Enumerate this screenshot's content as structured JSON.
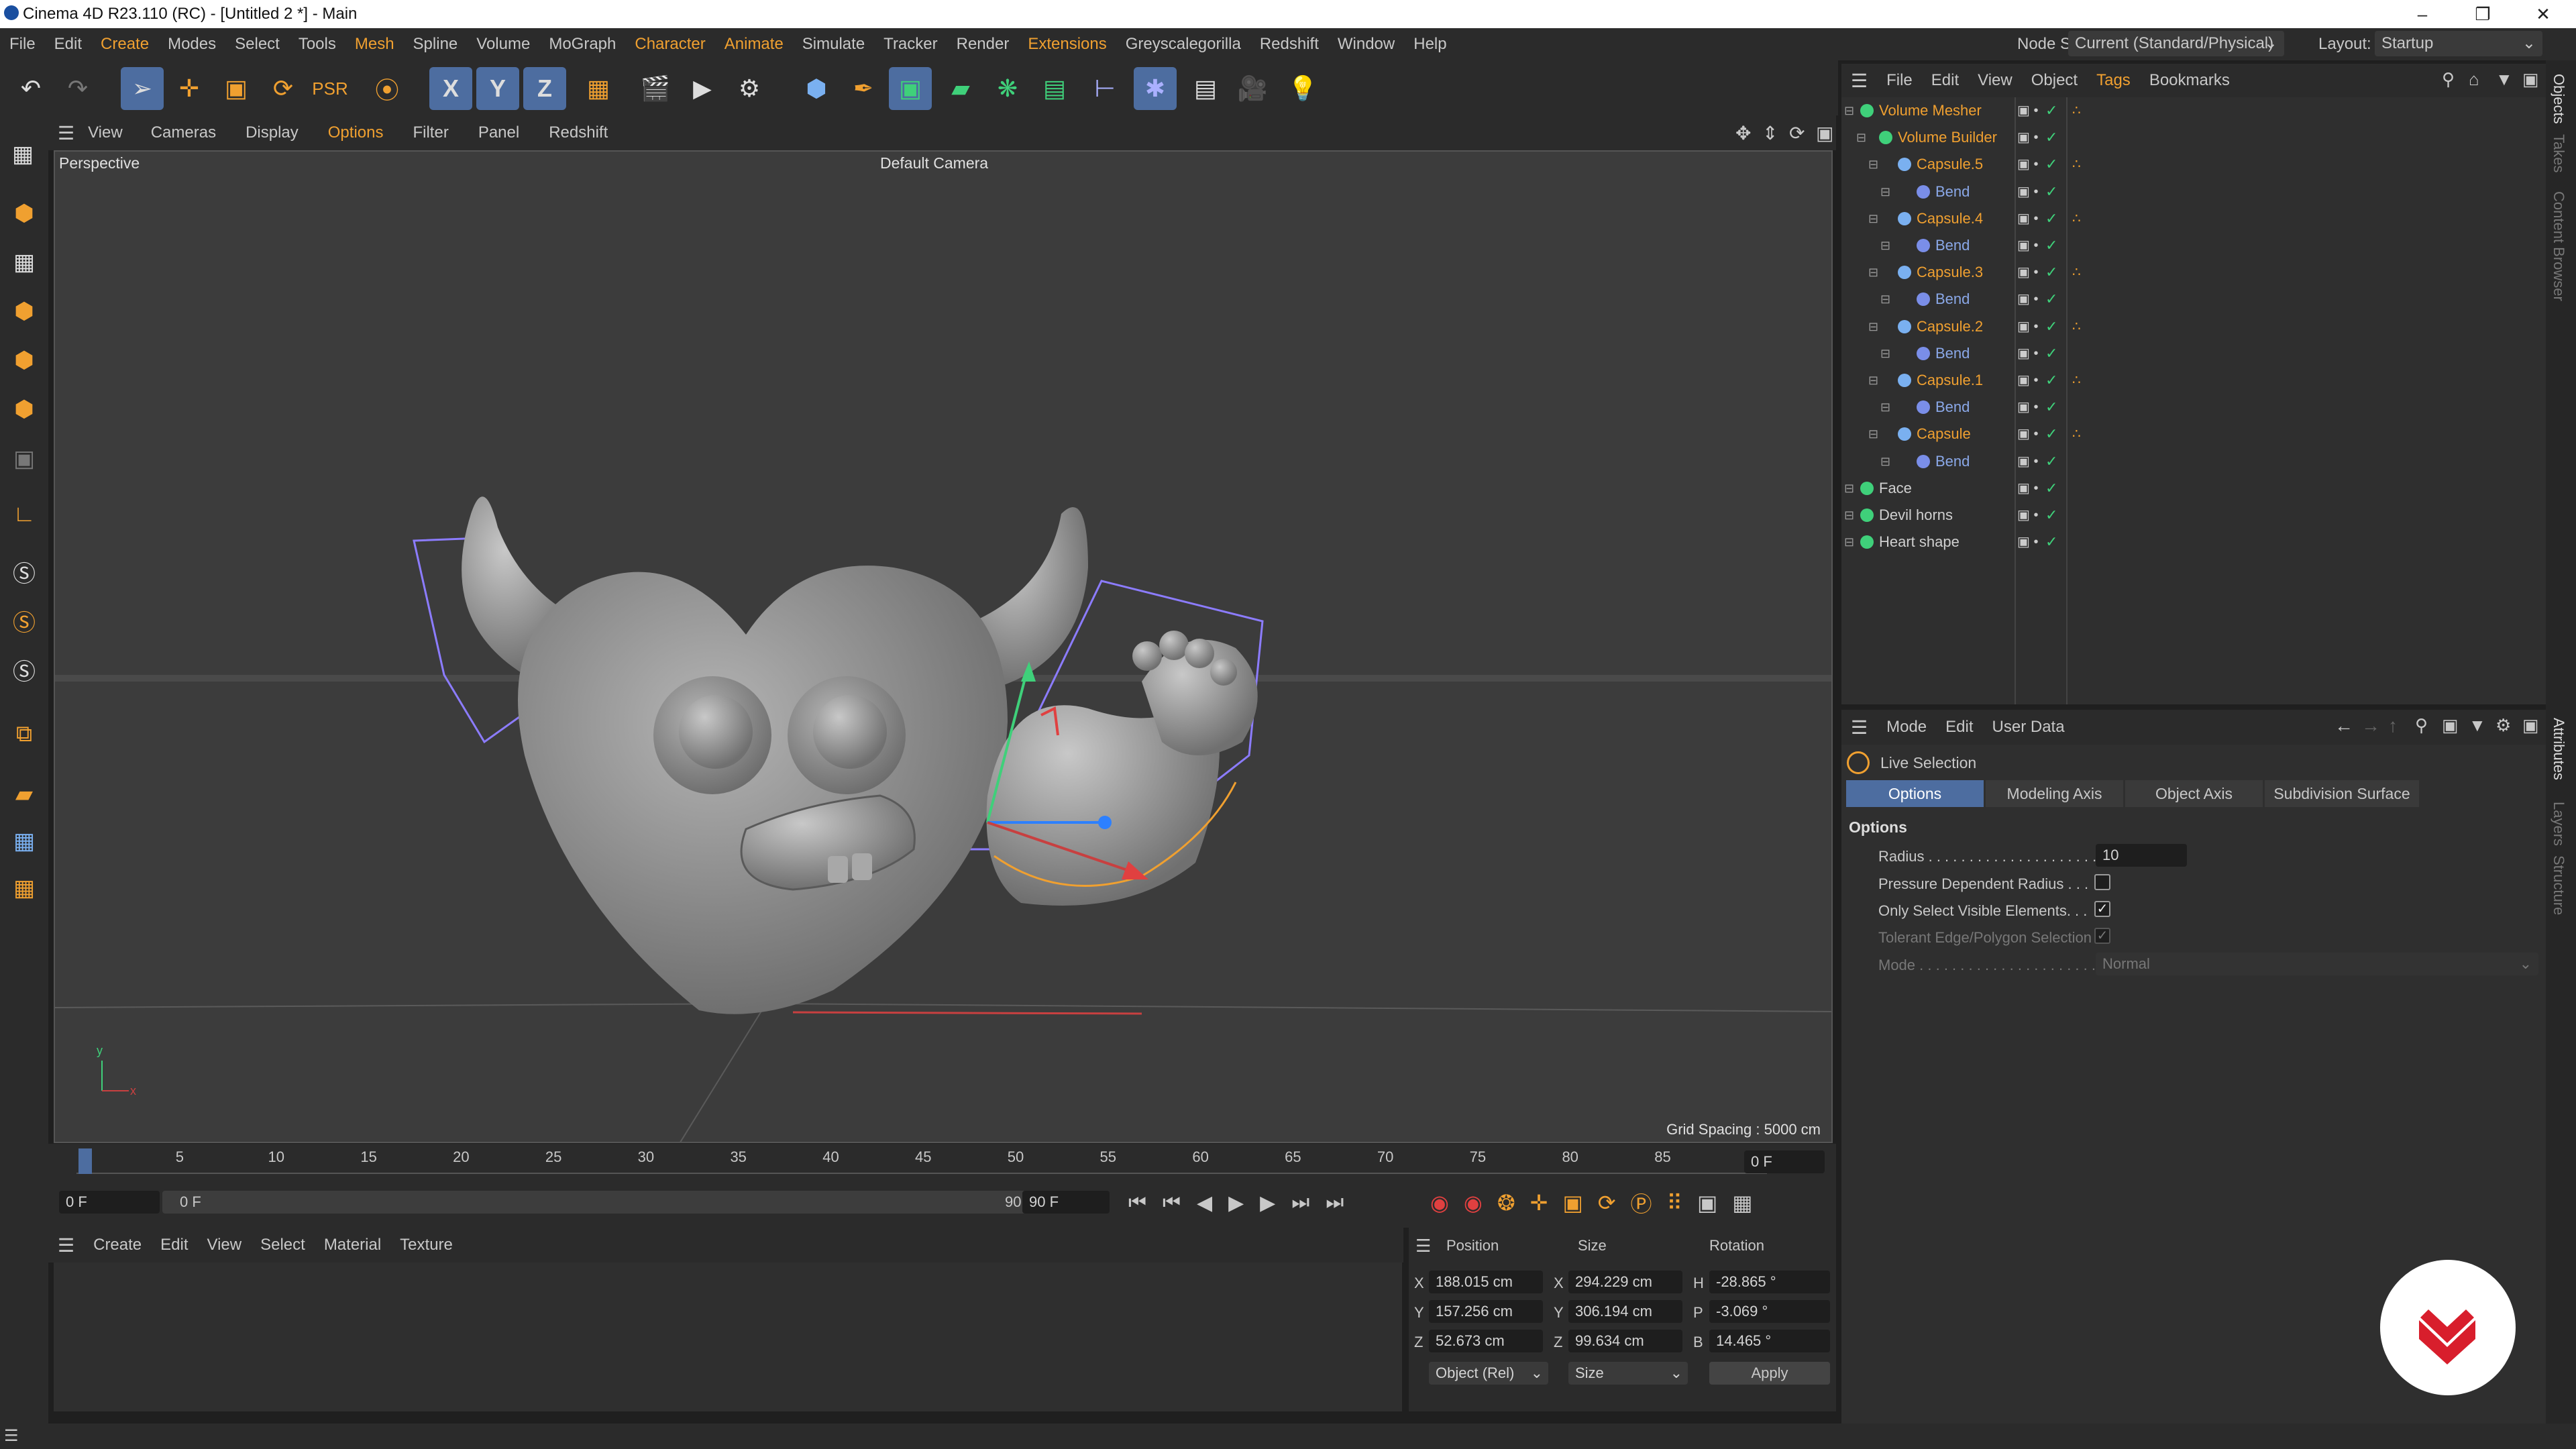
{
  "window": {
    "title": "Cinema 4D R23.110 (RC) - [Untitled 2 *] - Main"
  },
  "menubar": {
    "items": [
      "File",
      "Edit",
      "Create",
      "Modes",
      "Select",
      "Tools",
      "Mesh",
      "Spline",
      "Volume",
      "MoGraph",
      "Character",
      "Animate",
      "Simulate",
      "Tracker",
      "Render",
      "Extensions",
      "Greyscalegorilla",
      "Redshift",
      "Window",
      "Help"
    ],
    "node_space_label": "Node Space:",
    "node_space_value": "Current (Standard/Physical)",
    "layout_label": "Layout:",
    "layout_value": "Startup"
  },
  "toolbar": {
    "axis_x": "X",
    "axis_y": "Y",
    "axis_z": "Z"
  },
  "viewport_menu": {
    "items": [
      "View",
      "Cameras",
      "Display",
      "Options",
      "Filter",
      "Panel",
      "Redshift"
    ]
  },
  "viewport": {
    "view_name": "Perspective",
    "camera": "Default Camera",
    "grid_spacing": "Grid Spacing : 5000 cm",
    "axis_y": "y",
    "axis_x": "x"
  },
  "timeline": {
    "ticks": [
      "0",
      "5",
      "10",
      "15",
      "20",
      "25",
      "30",
      "35",
      "40",
      "45",
      "50",
      "55",
      "60",
      "65",
      "70",
      "75",
      "80",
      "85",
      "90"
    ],
    "current_frame": "0 F",
    "start": "0 F",
    "range_start": "0 F",
    "range_end": "90 F",
    "end": "90 F"
  },
  "material_menu": {
    "items": [
      "Create",
      "Edit",
      "View",
      "Select",
      "Material",
      "Texture"
    ]
  },
  "coordinates": {
    "headers": {
      "position": "Position",
      "size": "Size",
      "rotation": "Rotation"
    },
    "rows": [
      {
        "axis": "X",
        "pos": "188.015 cm",
        "saxis": "X",
        "size": "294.229 cm",
        "raxis": "H",
        "rot": "-28.865 °"
      },
      {
        "axis": "Y",
        "pos": "157.256 cm",
        "saxis": "Y",
        "size": "306.194 cm",
        "raxis": "P",
        "rot": "-3.069 °"
      },
      {
        "axis": "Z",
        "pos": "52.673 cm",
        "saxis": "Z",
        "size": "99.634 cm",
        "raxis": "B",
        "rot": "14.465 °"
      }
    ],
    "mode_select": "Object (Rel)",
    "size_select": "Size",
    "apply": "Apply"
  },
  "object_menu": {
    "items": [
      "File",
      "Edit",
      "View",
      "Object",
      "Tags",
      "Bookmarks"
    ]
  },
  "objects": [
    {
      "name": "Volume Mesher",
      "indent": 0,
      "color": "#f0a030"
    },
    {
      "name": "Volume Builder",
      "indent": 1,
      "color": "#f0a030"
    },
    {
      "name": "Capsule.5",
      "indent": 2,
      "color": "#f0a030"
    },
    {
      "name": "Bend",
      "indent": 3,
      "color": "#8aa8e8"
    },
    {
      "name": "Capsule.4",
      "indent": 2,
      "color": "#f0a030"
    },
    {
      "name": "Bend",
      "indent": 3,
      "color": "#8aa8e8"
    },
    {
      "name": "Capsule.3",
      "indent": 2,
      "color": "#f0a030"
    },
    {
      "name": "Bend",
      "indent": 3,
      "color": "#8aa8e8"
    },
    {
      "name": "Capsule.2",
      "indent": 2,
      "color": "#f0a030"
    },
    {
      "name": "Bend",
      "indent": 3,
      "color": "#8aa8e8"
    },
    {
      "name": "Capsule.1",
      "indent": 2,
      "color": "#f0a030"
    },
    {
      "name": "Bend",
      "indent": 3,
      "color": "#8aa8e8"
    },
    {
      "name": "Capsule",
      "indent": 2,
      "color": "#f0a030"
    },
    {
      "name": "Bend",
      "indent": 3,
      "color": "#8aa8e8"
    },
    {
      "name": "Face",
      "indent": 0,
      "color": "#d0d0d0"
    },
    {
      "name": "Devil horns",
      "indent": 0,
      "color": "#d0d0d0"
    },
    {
      "name": "Heart shape",
      "indent": 0,
      "color": "#d0d0d0"
    }
  ],
  "attributes": {
    "menu": [
      "Mode",
      "Edit",
      "User Data"
    ],
    "tool_name": "Live Selection",
    "tabs": [
      "Options",
      "Modeling Axis",
      "Object Axis",
      "Subdivision Surface"
    ],
    "section": "Options",
    "radius_label": "Radius . . . . . . . . . . . . . . . . . . . . . .",
    "radius_value": "10",
    "pressure_label": "Pressure Dependent Radius . . .",
    "visible_label": "Only Select Visible Elements. . .",
    "tolerant_label": "Tolerant Edge/Polygon Selection",
    "mode_label": "Mode . . . . . . . . . . . . . . . . . . . . . . .",
    "mode_value": "Normal"
  },
  "side_tabs": [
    "Objects",
    "Takes",
    "Content Browser",
    "Attributes",
    "Layers",
    "Structure"
  ],
  "colors": {
    "accent": "#4d6da0",
    "highlight": "#f0a030",
    "bg": "#2b2b2b",
    "viewport": "#3c3c3c"
  }
}
